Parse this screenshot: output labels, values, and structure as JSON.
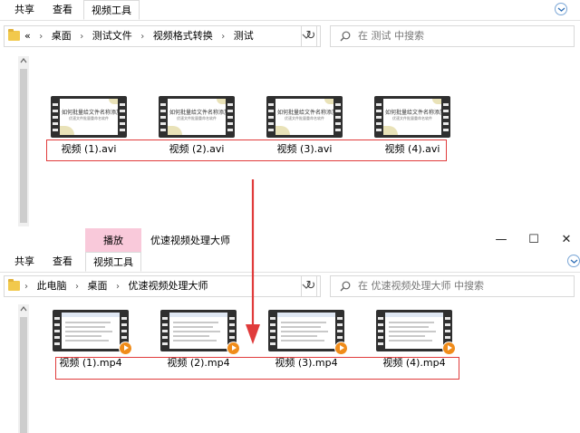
{
  "top_window": {
    "ribbon": {
      "tabs": [
        {
          "label": "共享"
        },
        {
          "label": "查看"
        },
        {
          "label": "视频工具"
        }
      ]
    },
    "address": {
      "prefix": "«",
      "crumbs": [
        "桌面",
        "测试文件",
        "视频格式转换",
        "测试"
      ]
    },
    "search_placeholder": "在 测试 中搜索",
    "slide_title": "如何批量给文件名称添加序号",
    "slide_subtitle": "优速文件批量重命名软件",
    "files": [
      {
        "name": "视频 (1).avi"
      },
      {
        "name": "视频 (2).avi"
      },
      {
        "name": "视频 (3).avi"
      },
      {
        "name": "视频 (4).avi"
      }
    ]
  },
  "bottom_window": {
    "contextual_tab": "播放",
    "title": "优速视频处理大师",
    "controls": {
      "minimize": "—",
      "maximize": "☐",
      "close": "✕"
    },
    "ribbon": {
      "tabs": [
        {
          "label": "共享"
        },
        {
          "label": "查看"
        },
        {
          "label": "视频工具"
        }
      ]
    },
    "address": {
      "crumbs": [
        "此电脑",
        "桌面",
        "优速视频处理大师"
      ]
    },
    "search_placeholder": "在 优速视频处理大师 中搜索",
    "files": [
      {
        "name": "视频 (1).mp4"
      },
      {
        "name": "视频 (2).mp4"
      },
      {
        "name": "视频 (3).mp4"
      },
      {
        "name": "视频 (4).mp4"
      }
    ]
  },
  "colors": {
    "highlight_red": "#e03b3b",
    "context_tab_pink": "#f9c9da",
    "play_badge": "#f08c1a",
    "folder_yellow": "#f2c94c"
  },
  "icons": [
    "folder-icon",
    "refresh-icon",
    "search-icon",
    "chevron-down-icon",
    "help-icon",
    "play-icon"
  ]
}
